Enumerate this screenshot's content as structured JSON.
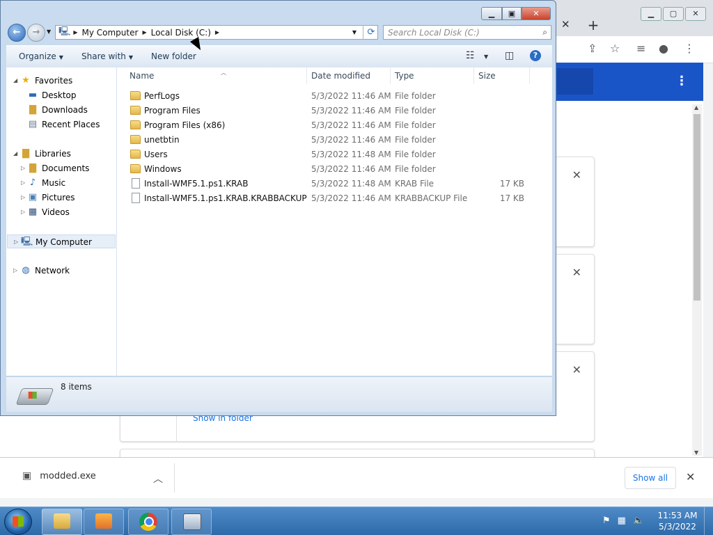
{
  "explorer": {
    "address": {
      "crumbs": [
        "My Computer",
        "Local Disk (C:)"
      ]
    },
    "search": {
      "placeholder": "Search Local Disk (C:)"
    },
    "commands": {
      "organize": "Organize",
      "share_with": "Share with",
      "new_folder": "New folder"
    },
    "nav": {
      "favorites": "Favorites",
      "desktop": "Desktop",
      "downloads": "Downloads",
      "recent_places": "Recent Places",
      "libraries": "Libraries",
      "documents": "Documents",
      "music": "Music",
      "pictures": "Pictures",
      "videos": "Videos",
      "my_computer": "My Computer",
      "network": "Network"
    },
    "columns": {
      "name": "Name",
      "date_modified": "Date modified",
      "type": "Type",
      "size": "Size"
    },
    "files": [
      {
        "name": "PerfLogs",
        "date": "5/3/2022 11:46 AM",
        "type": "File folder",
        "size": ""
      },
      {
        "name": "Program Files",
        "date": "5/3/2022 11:46 AM",
        "type": "File folder",
        "size": ""
      },
      {
        "name": "Program Files (x86)",
        "date": "5/3/2022 11:46 AM",
        "type": "File folder",
        "size": ""
      },
      {
        "name": "unetbtin",
        "date": "5/3/2022 11:46 AM",
        "type": "File folder",
        "size": ""
      },
      {
        "name": "Users",
        "date": "5/3/2022 11:48 AM",
        "type": "File folder",
        "size": ""
      },
      {
        "name": "Windows",
        "date": "5/3/2022 11:46 AM",
        "type": "File folder",
        "size": ""
      },
      {
        "name": "Install-WMF5.1.ps1.KRAB",
        "date": "5/3/2022 11:48 AM",
        "type": "KRAB File",
        "size": "17 KB"
      },
      {
        "name": "Install-WMF5.1.ps1.KRAB.KRABBACKUP",
        "date": "5/3/2022 11:46 AM",
        "type": "KRABBACKUP File",
        "size": "17 KB"
      }
    ],
    "status": {
      "item_count": "8 items"
    }
  },
  "chrome": {
    "card_link": "Show in folder",
    "download": {
      "filename": "modded.exe",
      "show_all": "Show all"
    }
  },
  "taskbar": {
    "time": "11:53 AM",
    "date": "5/3/2022"
  },
  "colors": {
    "chrome_banner": "#1a55c8",
    "taskbar": "#2d6aa9",
    "folder": "#e4b84a"
  }
}
